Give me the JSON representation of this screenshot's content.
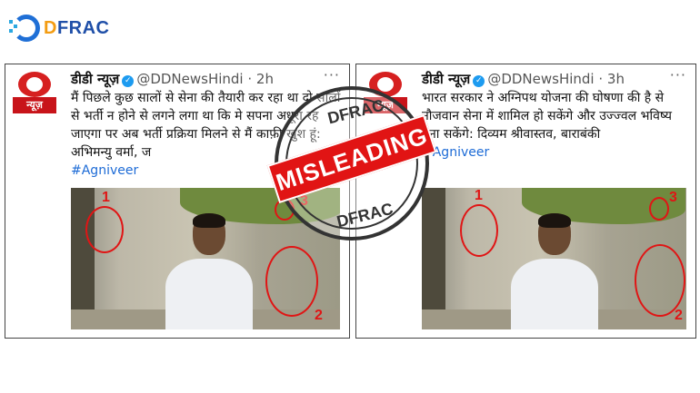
{
  "logo": {
    "text_main": "DFRAC",
    "text_lead": "D",
    "text_rest": "FRAC"
  },
  "tweets": [
    {
      "name": "डीडी न्यूज़",
      "handle": "@DDNewsHindi",
      "time": "· 2h",
      "more": "···",
      "body": "मैं पिछले कुछ सालों से सेना की तैयारी कर रहा था दो सालों से भर्ती न होने से लगने लगा था कि मे सपना अधूरा रह जाएगा पर अब भर्ती प्रक्रिया मिलने से मैं काफ़ी खुश हूं: अभिमन्यु वर्मा, ज",
      "hashtag": "#Agniveer",
      "avatar_label": "न्यूज़",
      "annotations": [
        "1",
        "2",
        "3"
      ]
    },
    {
      "name": "डीडी न्यूज़",
      "handle": "@DDNewsHindi",
      "time": "· 3h",
      "more": "···",
      "body": "भारत सरकार ने अग्निपथ योजना की घोषणा की है से नौजवान सेना में शामिल हो सकेंगे और उज्ज्वल भविष्य बना सकेंगे: दिव्यम श्रीवास्तव, बाराबंकी",
      "hashtag": "#Agniveer",
      "avatar_label": "न्यूज़",
      "annotations": [
        "1",
        "2",
        "3"
      ]
    }
  ],
  "stamp": {
    "label": "MISLEADING",
    "top_text": "DFRAC",
    "bottom_text": "DFRAC"
  },
  "colors": {
    "accent_red": "#e01515",
    "link_blue": "#1d6bd6",
    "verified": "#1d9bf0"
  }
}
